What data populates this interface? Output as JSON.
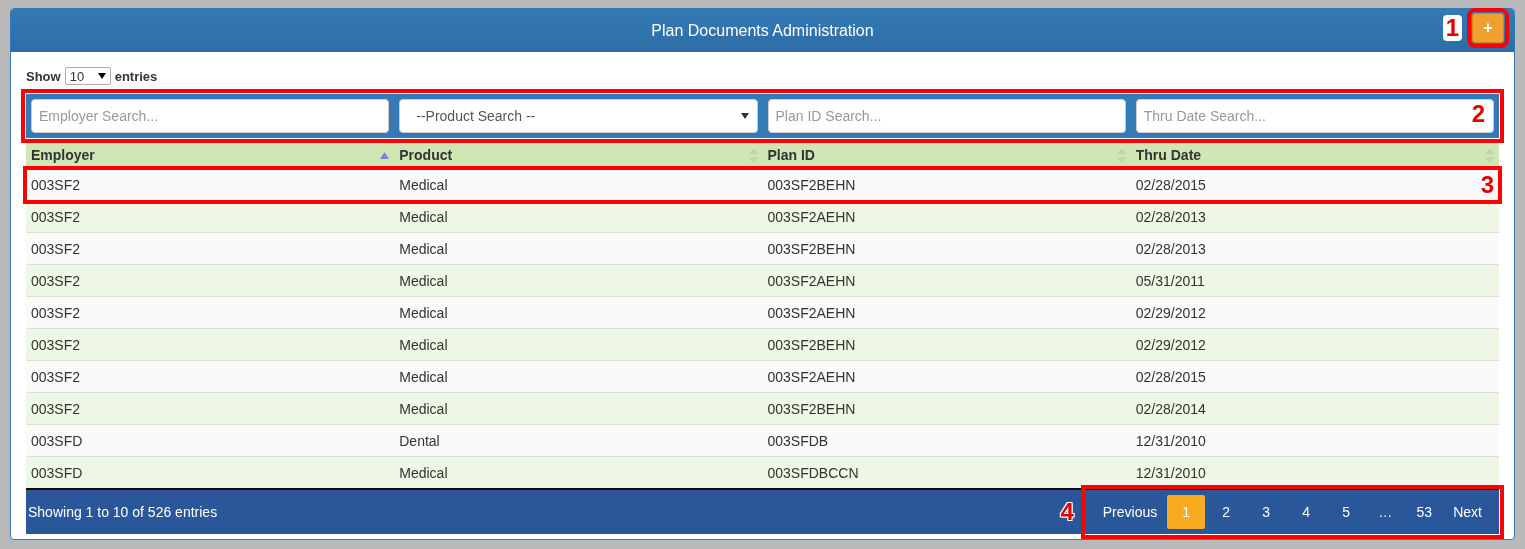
{
  "panel": {
    "title": "Plan Documents Administration",
    "add_button": {
      "label": "+",
      "callout": "1"
    }
  },
  "length_menu": {
    "prefix": "Show",
    "value": "10",
    "suffix": "entries"
  },
  "filters": {
    "callout": "2",
    "fields": [
      {
        "kind": "text",
        "placeholder": "Employer Search..."
      },
      {
        "kind": "select",
        "value": "--Product Search --"
      },
      {
        "kind": "text",
        "placeholder": "Plan ID Search..."
      },
      {
        "kind": "text",
        "placeholder": "Thru Date Search..."
      }
    ]
  },
  "table": {
    "columns": [
      {
        "label": "Employer",
        "sorted": true
      },
      {
        "label": "Product",
        "sorted": false
      },
      {
        "label": "Plan ID",
        "sorted": false
      },
      {
        "label": "Thru Date",
        "sorted": false
      }
    ],
    "rows": [
      {
        "cells": [
          "003SF2",
          "Medical",
          "003SF2BEHN",
          "02/28/2015"
        ],
        "callout": "3"
      },
      {
        "cells": [
          "003SF2",
          "Medical",
          "003SF2AEHN",
          "02/28/2013"
        ]
      },
      {
        "cells": [
          "003SF2",
          "Medical",
          "003SF2BEHN",
          "02/28/2013"
        ]
      },
      {
        "cells": [
          "003SF2",
          "Medical",
          "003SF2AEHN",
          "05/31/2011"
        ]
      },
      {
        "cells": [
          "003SF2",
          "Medical",
          "003SF2AEHN",
          "02/29/2012"
        ]
      },
      {
        "cells": [
          "003SF2",
          "Medical",
          "003SF2BEHN",
          "02/29/2012"
        ]
      },
      {
        "cells": [
          "003SF2",
          "Medical",
          "003SF2AEHN",
          "02/28/2015"
        ]
      },
      {
        "cells": [
          "003SF2",
          "Medical",
          "003SF2BEHN",
          "02/28/2014"
        ]
      },
      {
        "cells": [
          "003SFD",
          "Dental",
          "003SFDB",
          "12/31/2010"
        ]
      },
      {
        "cells": [
          "003SFD",
          "Medical",
          "003SFDBCCN",
          "12/31/2010"
        ]
      }
    ]
  },
  "footer": {
    "info": "Showing 1 to 10 of 526 entries",
    "pagination": {
      "callout": "4",
      "items": [
        {
          "label": "Previous",
          "kind": "link",
          "selected": false
        },
        {
          "label": "1",
          "kind": "page",
          "selected": true
        },
        {
          "label": "2",
          "kind": "page",
          "selected": false
        },
        {
          "label": "3",
          "kind": "page",
          "selected": false
        },
        {
          "label": "4",
          "kind": "page",
          "selected": false
        },
        {
          "label": "5",
          "kind": "page",
          "selected": false
        },
        {
          "label": "…",
          "kind": "ellipsis",
          "selected": false
        },
        {
          "label": "53",
          "kind": "page",
          "selected": false
        },
        {
          "label": "Next",
          "kind": "link",
          "selected": false
        }
      ]
    }
  }
}
